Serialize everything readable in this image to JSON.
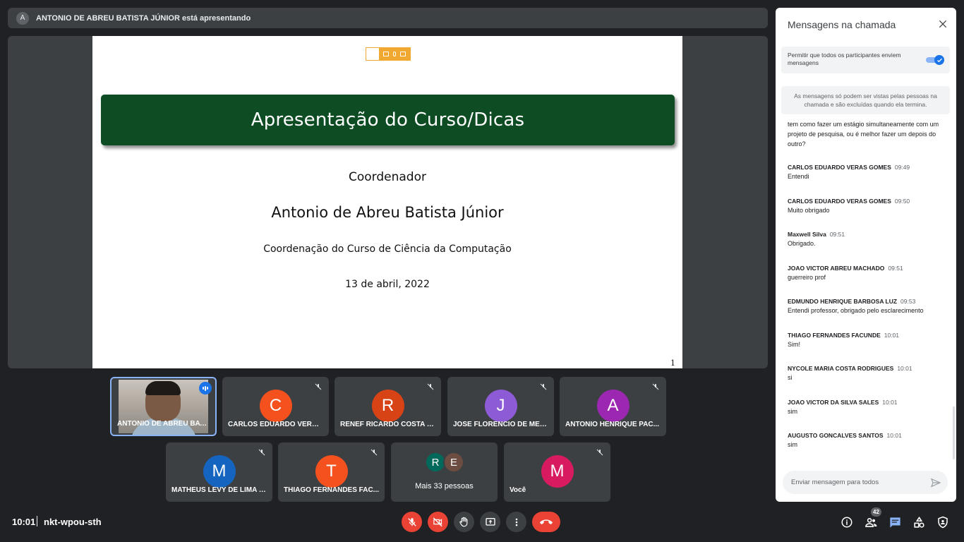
{
  "presenter": {
    "avatar_letter": "A",
    "text": "ANTONIO DE ABREU BATISTA JÚNIOR está apresentando"
  },
  "slide": {
    "title": "Apresentação do Curso/Dicas",
    "role": "Coordenador",
    "name": "Antonio de Abreu Batista Júnior",
    "department": "Coordenação do Curso de Ciência da Computação",
    "date": "13 de abril, 2022",
    "page": "1"
  },
  "tiles": [
    {
      "name": "ANTONIO DE ABREU BATI...",
      "type": "video"
    },
    {
      "name": "CARLOS EDUARDO VERAS...",
      "letter": "C",
      "color": "#f4511e"
    },
    {
      "name": "RENEF RICARDO COSTA D...",
      "letter": "R",
      "color": "#d84315"
    },
    {
      "name": "JOSE FLORENCIO DE MEL...",
      "letter": "J",
      "color": "#8e5bd6"
    },
    {
      "name": "ANTONIO HENRIQUE PAC...",
      "letter": "A",
      "color": "#9c27b0"
    },
    {
      "name": "MATHEUS LEVY DE LIMA B...",
      "letter": "M",
      "color": "#1565c0"
    },
    {
      "name": "THIAGO FERNANDES FAC...",
      "letter": "T",
      "color": "#f4511e"
    },
    {
      "name": "Mais 33 pessoas",
      "letters": [
        "R",
        "E"
      ],
      "colors": [
        "#00695c",
        "#6d4c41"
      ]
    },
    {
      "name": "Você",
      "letter": "M",
      "color": "#d81b60"
    }
  ],
  "meeting": {
    "time": "10:01",
    "code": "nkt-wpou-sth",
    "participant_count": "42"
  },
  "chat": {
    "title": "Mensagens na chamada",
    "permit_text": "Permitir que todos os participantes enviem mensagens",
    "permit_enabled": true,
    "notice": "As mensagens só podem ser vistas pelas pessoas na chamada e são excluídas quando ela termina.",
    "continued_message": "tem como fazer um estágio simultaneamente com um projeto de pesquisa,  ou é melhor fazer um depois do outro?",
    "messages": [
      {
        "sender": "CARLOS EDUARDO VERAS GOMES",
        "time": "09:49",
        "text": "Entendi"
      },
      {
        "sender": "CARLOS EDUARDO VERAS GOMES",
        "time": "09:50",
        "text": "Muito obrigado"
      },
      {
        "sender": "Maxwell Silva",
        "time": "09:51",
        "text": "Obrigado."
      },
      {
        "sender": "JOAO VICTOR ABREU MACHADO",
        "time": "09:51",
        "text": "guerreiro prof"
      },
      {
        "sender": "EDMUNDO HENRIQUE BARBOSA LUZ",
        "time": "09:53",
        "text": "Entendi professor, obrigado pelo esclarecimento"
      },
      {
        "sender": "THIAGO FERNANDES FACUNDE",
        "time": "10:01",
        "text": "Sim!"
      },
      {
        "sender": "NYCOLE MARIA COSTA RODRIGUES",
        "time": "10:01",
        "text": "si"
      },
      {
        "sender": "JOAO VICTOR DA SILVA SALES",
        "time": "10:01",
        "text": "sim"
      },
      {
        "sender": "AUGUSTO GONCALVES SANTOS",
        "time": "10:01",
        "text": "sim"
      }
    ],
    "input_placeholder": "Enviar mensagem para todos"
  },
  "icons": {
    "mic_off": "mic-off-icon",
    "cam_off": "camera-off-icon",
    "raise_hand": "raise-hand-icon",
    "present": "present-screen-icon",
    "more": "more-options-icon",
    "end_call": "end-call-icon",
    "info": "info-icon",
    "people": "people-icon",
    "chat": "chat-icon",
    "activities": "activities-icon",
    "host_controls": "host-controls-icon",
    "send": "send-icon",
    "close": "close-icon"
  },
  "colors": {
    "background": "#202124",
    "tile": "#3c4043",
    "red": "#ea4335",
    "blue": "#1a73e8",
    "slide_banner": "#0e4d23"
  }
}
